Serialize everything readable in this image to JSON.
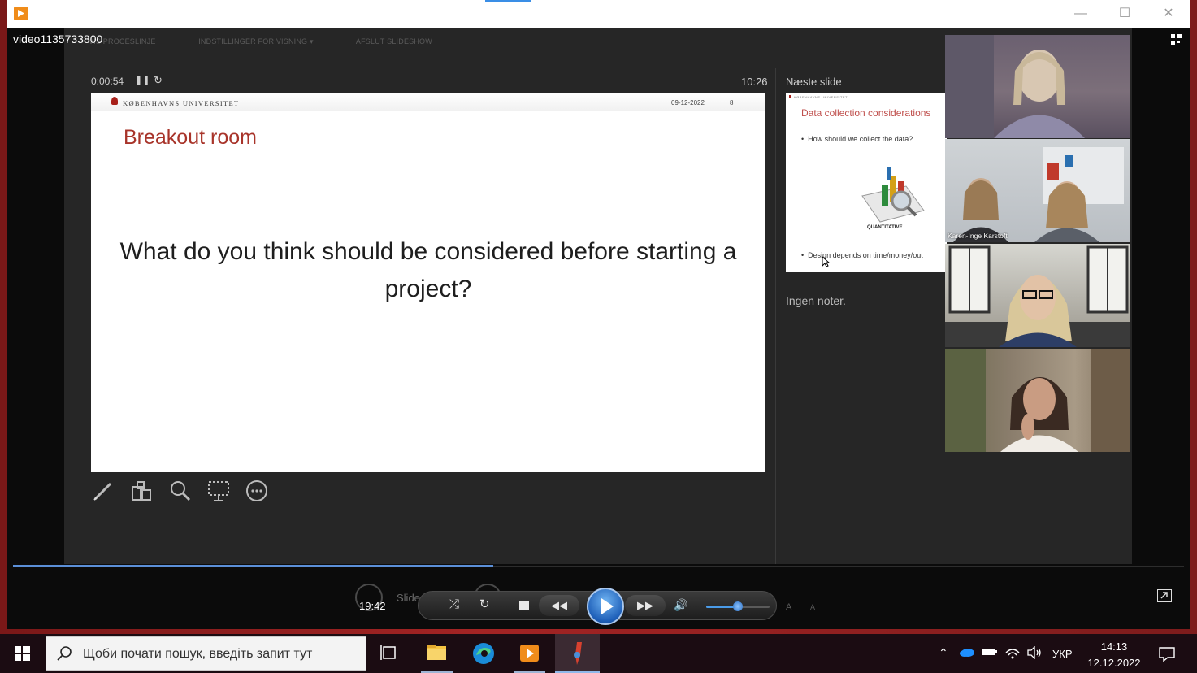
{
  "window": {
    "video_title": "video1135733800",
    "controls": {
      "minimize": "—",
      "maximize": "☐",
      "close": "✕"
    }
  },
  "presenter": {
    "toolbar": [
      "VIS PROCESLINJE",
      "INDSTILLINGER FOR VISNING ▾",
      "AFSLUT SLIDESHOW"
    ],
    "elapsed": "0:00:54",
    "clock": "10:26",
    "next_slide_label": "Næste slide",
    "notes": "Ingen noter.",
    "current_slide": {
      "university": "KØBENHAVNS UNIVERSITET",
      "date": "09-12-2022",
      "number": "8",
      "title": "Breakout room",
      "question": "What do you think should be considered before starting a project?"
    },
    "next_slide": {
      "header": "KØBENHAVNS UNIVERSITET",
      "title": "Data collection considerations",
      "bullet1": "How should we collect the data?",
      "graphic_label": "QUANTITATIVE",
      "bullet2": "Design depends on time/money/out"
    },
    "tools": [
      "pen-icon",
      "slides-grid-icon",
      "zoom-icon",
      "screen-icon",
      "more-icon"
    ]
  },
  "participants": [
    {
      "name": ""
    },
    {
      "name": "Karen-Inge Karstoft"
    },
    {
      "name": ""
    },
    {
      "name": ""
    }
  ],
  "player": {
    "time_now": "19:42",
    "slide_counter": "Slide 8 af 20",
    "progress": 0.41,
    "volume": 0.5,
    "buttons": {
      "shuffle": "⤮",
      "repeat": "↻",
      "rewind": "◀◀",
      "forward": "▶▶",
      "volume": "🔊"
    },
    "font_large": "A",
    "font_small": "A"
  },
  "taskbar": {
    "search_placeholder": "Щоби почати пошук, введіть запит тут",
    "language": "УКР",
    "time": "14:13",
    "date": "12.12.2022"
  },
  "colors": {
    "slide_title": "#a8342a",
    "accent_blue": "#5b8fd8",
    "taskbar_bg": "#1b0c12"
  }
}
